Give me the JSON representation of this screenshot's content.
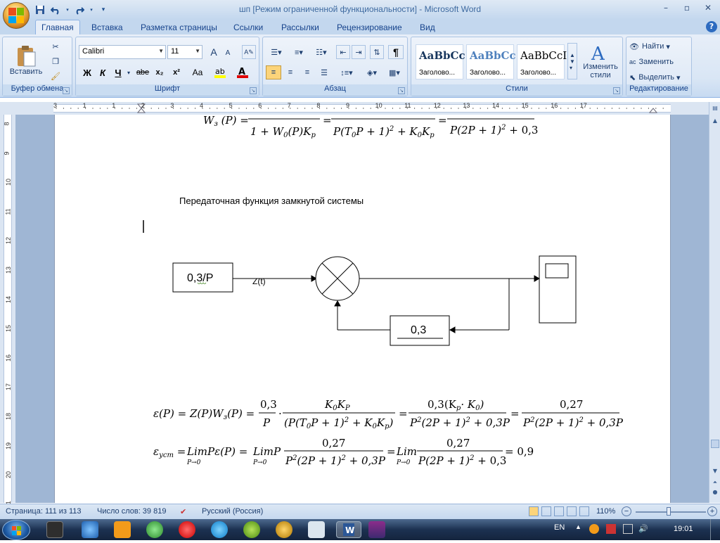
{
  "window": {
    "title": "шп [Режим ограниченной функциональности] - Microsoft Word",
    "controls": [
      "minimize",
      "restore",
      "close"
    ]
  },
  "tabs": [
    "Главная",
    "Вставка",
    "Разметка страницы",
    "Ссылки",
    "Рассылки",
    "Рецензирование",
    "Вид"
  ],
  "ribbon": {
    "clipboard": {
      "label": "Буфер обмена",
      "paste": "Вставить"
    },
    "font": {
      "label": "Шрифт",
      "name": "Calibri",
      "size": "11",
      "bold": "Ж",
      "italic": "К",
      "underline": "Ч",
      "strike": "abe",
      "sub": "x₂",
      "sup": "x²",
      "case": "Aa",
      "grow": "A",
      "shrink": "A"
    },
    "paragraph": {
      "label": "Абзац",
      "pilcrow": "¶"
    },
    "styles": {
      "label": "Стили",
      "tiles": [
        {
          "sample": "AaBbCc",
          "name": "Заголово..."
        },
        {
          "sample": "AaBbCc",
          "name": "Заголово..."
        },
        {
          "sample": "AaBbCcI",
          "name": "Заголово..."
        }
      ],
      "change": "Изменить стили"
    },
    "editing": {
      "label": "Редактирование",
      "find": "Найти",
      "replace": "Заменить",
      "select": "Выделить"
    }
  },
  "ruler": {
    "numbers": [
      "3",
      "1",
      "1",
      "2",
      "3",
      "4",
      "5",
      "6",
      "7",
      "8",
      "9",
      "10",
      "11",
      "12",
      "13",
      "14",
      "15",
      "16",
      "17"
    ]
  },
  "vruler": {
    "numbers": [
      "8",
      "9",
      "10",
      "11",
      "12",
      "13",
      "14",
      "15",
      "16",
      "17",
      "18",
      "19",
      "20",
      "21"
    ]
  },
  "document": {
    "top_formula": {
      "lhs": "W",
      "lhs_sub": "з",
      "arg": "(P) =",
      "f1_den": "1 + W",
      "f1_den_sub": "0",
      "f1_den_rest": "(P)K",
      "f1_den_sub2": "p",
      "eq1": "=",
      "f2_den": "P(T",
      "f2_den_sub": "0",
      "f2_den_rest": "P + 1)",
      "f2_den_sup": "2",
      "f2_den_tail": "+ K",
      "f2_den_sub2": "0",
      "f2_den_tail2": "K",
      "f2_den_sub3": "p",
      "eq2": "=",
      "f3_den": "P(2P + 1)",
      "f3_den_sup": "2",
      "f3_den_tail": "+ 0,3"
    },
    "heading": "Передаточная функция замкнутой системы",
    "diagram": {
      "block1": "0,3/P",
      "signal": "Z(t)",
      "feedback": "0,3"
    },
    "eq1": {
      "lhs": "ε(P) = Z(P)W",
      "lhs_sub": "з",
      "lhs_tail": "(P) =",
      "frac1_num": "0,3",
      "frac1_den": "P",
      "dot": "·",
      "frac2_num": "K",
      "frac2_num_sub": "0",
      "frac2_num_tail": "K",
      "frac2_num_sub2": "P",
      "frac2_den": "(P(T",
      "frac2_den_sub": "0",
      "frac2_den_rest": "P + 1)",
      "frac2_den_sup": "2",
      "frac2_den_tail": "+ K",
      "frac2_den_sub2": "0",
      "frac2_den_tail2": "K",
      "frac2_den_sub3": "p",
      "frac2_den_close": ")",
      "eq": "=",
      "frac3_num": "0,3(K",
      "frac3_num_sub": "p",
      "frac3_num_tail": "· K",
      "frac3_num_sub2": "0",
      "frac3_num_close": ")",
      "frac3_den": "P",
      "frac3_den_sup": "2",
      "frac3_den_rest": "(2P + 1)",
      "frac3_den_sup2": "2",
      "frac3_den_tail": "+ 0,3P",
      "eq2": "=",
      "frac4_num": "0,27",
      "frac4_den": "P",
      "frac4_den_sup": "2",
      "frac4_den_rest": "(2P + 1)",
      "frac4_den_sup2": "2",
      "frac4_den_tail": "+ 0,3P"
    },
    "eq2": {
      "lhs": "ε",
      "lhs_sub": "уст",
      "eq": "=",
      "lim1": "Lim",
      "lim1_sub": "P→0",
      "mid1": "Pε(P) =",
      "lim2": "Lim",
      "lim2_sub": "P→0",
      "mid2": "P",
      "frac1_num": "0,27",
      "frac1_den": "P",
      "frac1_den_sup": "2",
      "frac1_den_rest": "(2P + 1)",
      "frac1_den_sup2": "2",
      "frac1_den_tail": "+ 0,3P",
      "eq3": "=",
      "lim3": "Lim",
      "lim3_sub": "P→0",
      "frac2_num": "0,27",
      "frac2_den": "P(2P + 1)",
      "frac2_den_sup": "2",
      "frac2_den_tail": "+ 0,3",
      "result": "= 0,9"
    }
  },
  "status": {
    "page": "Страница: 111 из 113",
    "words": "Число слов: 39 819",
    "lang": "Русский (Россия)",
    "zoom": "110%"
  },
  "taskbar": {
    "lang": "EN",
    "time": "19:01"
  }
}
